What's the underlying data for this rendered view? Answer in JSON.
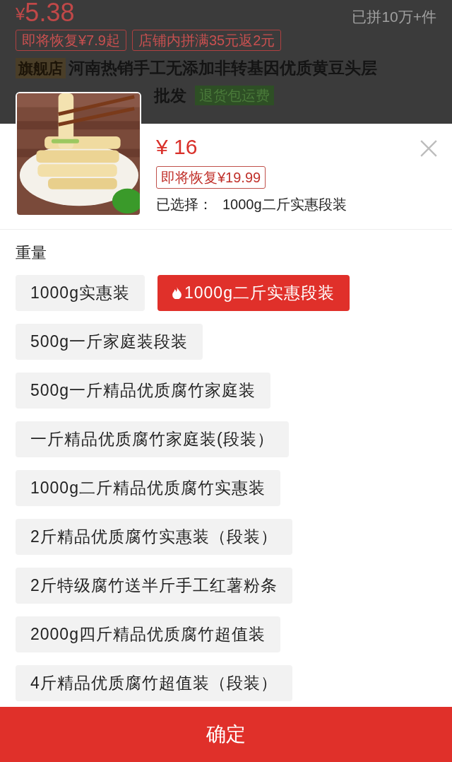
{
  "background_product": {
    "price_symbol": "¥",
    "price": "5.38",
    "sold": "已拼10万+件",
    "tags": [
      "即将恢复¥7.9起",
      "店铺内拼满35元返2元"
    ],
    "store_badge": "旗舰店",
    "title_line_1": "河南热销手工无添加非转基因优质黄豆头层",
    "title_line_2": "批发",
    "return_badge": "退货包运费"
  },
  "sku_sheet": {
    "price": "¥ 16",
    "original_price": "即将恢复¥19.99",
    "selected_label": "已选择：",
    "selected_value": "1000g二斤实惠段装",
    "group_title": "重量",
    "options": [
      {
        "label": "1000g实惠装",
        "selected": false,
        "hot": false
      },
      {
        "label": "1000g二斤实惠段装",
        "selected": true,
        "hot": true
      },
      {
        "label": "500g一斤家庭装段装",
        "selected": false,
        "hot": false
      },
      {
        "label": "500g一斤精品优质腐竹家庭装",
        "selected": false,
        "hot": false
      },
      {
        "label": "一斤精品优质腐竹家庭装(段装）",
        "selected": false,
        "hot": false
      },
      {
        "label": "1000g二斤精品优质腐竹实惠装",
        "selected": false,
        "hot": false
      },
      {
        "label": "2斤精品优质腐竹实惠装（段装）",
        "selected": false,
        "hot": false
      },
      {
        "label": "2斤特级腐竹送半斤手工红薯粉条",
        "selected": false,
        "hot": false
      },
      {
        "label": "2000g四斤精品优质腐竹超值装",
        "selected": false,
        "hot": false
      },
      {
        "label": "4斤精品优质腐竹超值装（段装）",
        "selected": false,
        "hot": false
      }
    ],
    "confirm": "确定"
  }
}
